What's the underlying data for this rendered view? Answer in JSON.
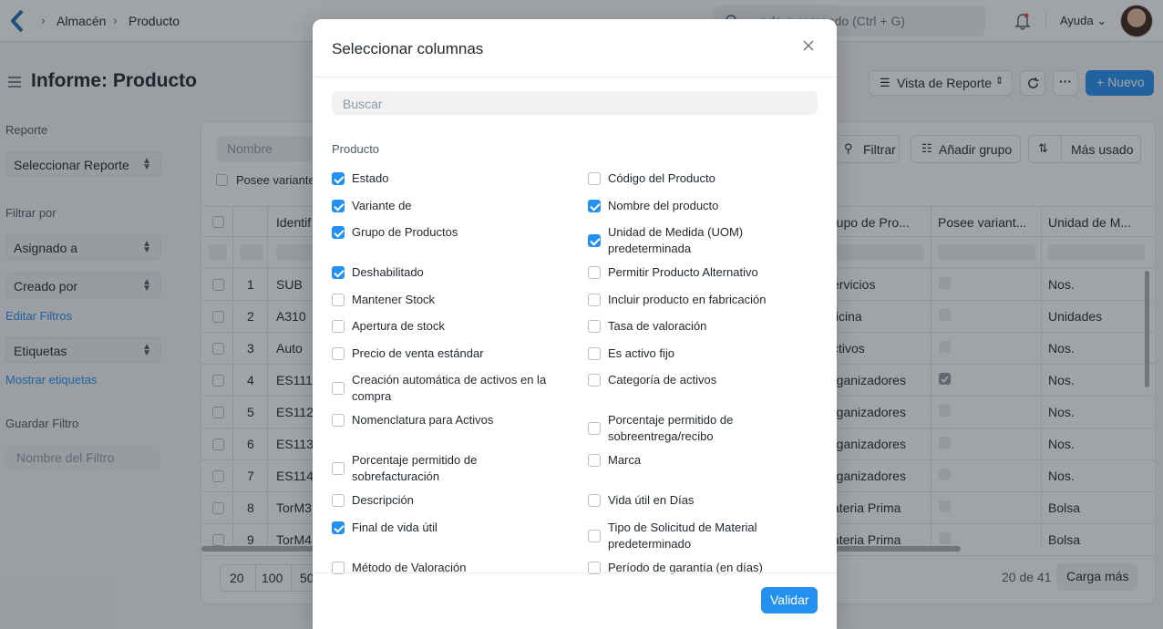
{
  "navbar": {
    "breadcrumbs": [
      "Almacén",
      "Producto"
    ],
    "search_placeholder": "Buscar o escriba una búsqueda o comando (Ctrl + G)",
    "search_visible": "...ada o comando (Ctrl + G)",
    "help_label": "Ayuda"
  },
  "header": {
    "title": "Informe: Producto",
    "view_label": "Vista de Reporte",
    "more_label": "···",
    "new_label": "+ Nuevo"
  },
  "sidebar": {
    "report_label": "Reporte",
    "report_select": "Seleccionar Reporte",
    "filter_by_label": "Filtrar por",
    "assigned_to": "Asignado a",
    "created_by": "Creado por",
    "edit_filters": "Editar Filtros",
    "tags": "Etiquetas",
    "show_tags": "Mostrar etiquetas",
    "save_filter_label": "Guardar Filtro",
    "filter_name_placeholder": "Nombre del Filtro"
  },
  "report": {
    "name_filter_placeholder": "Nombre",
    "variant_filter_label": "Posee variante",
    "filter_button": "Filtrar",
    "group_button": "Añadir grupo",
    "sort_button": "Más usado",
    "columns": [
      "Identif",
      "rupo de Pro...",
      "Posee variant...",
      "Unidad de M..."
    ],
    "rows": [
      {
        "n": "1",
        "id": "SUB",
        "group": "ervicios",
        "variant": false,
        "uom": "Nos."
      },
      {
        "n": "2",
        "id": "A310",
        "group": "ficina",
        "variant": false,
        "uom": "Unidades"
      },
      {
        "n": "3",
        "id": "Auto",
        "group": "ctivos",
        "variant": false,
        "uom": "Nos."
      },
      {
        "n": "4",
        "id": "ES111",
        "group": "rganizadores",
        "variant": true,
        "uom": "Nos."
      },
      {
        "n": "5",
        "id": "ES112",
        "group": "rganizadores",
        "variant": false,
        "uom": "Nos."
      },
      {
        "n": "6",
        "id": "ES113",
        "group": "rganizadores",
        "variant": false,
        "uom": "Nos."
      },
      {
        "n": "7",
        "id": "ES114",
        "group": "rganizadores",
        "variant": false,
        "uom": "Nos."
      },
      {
        "n": "8",
        "id": "TorM3",
        "group": "ateria Prima",
        "variant": false,
        "uom": "Bolsa"
      },
      {
        "n": "9",
        "id": "TorM4",
        "group": "ateria Prima",
        "variant": false,
        "uom": "Bolsa"
      }
    ],
    "page_sizes": [
      "20",
      "100",
      "50"
    ],
    "count_text": "20 de 41",
    "load_more": "Carga más"
  },
  "modal": {
    "title": "Seleccionar columnas",
    "search_placeholder": "Buscar",
    "section": "Producto",
    "options_left": [
      {
        "label": "Estado",
        "checked": true
      },
      {
        "label": "Variante de",
        "checked": true
      },
      {
        "label": "Grupo de Productos",
        "checked": true
      },
      {
        "label": "Deshabilitado",
        "checked": true
      },
      {
        "label": "Mantener Stock",
        "checked": false
      },
      {
        "label": "Apertura de stock",
        "checked": false
      },
      {
        "label": "Precio de venta estándar",
        "checked": false
      },
      {
        "label": "Creación automática de activos en la compra",
        "checked": false
      },
      {
        "label": "Nomenclatura para Activos",
        "checked": false
      },
      {
        "label": "Porcentaje permitido de sobrefacturación",
        "checked": false
      },
      {
        "label": "Descripción",
        "checked": false
      },
      {
        "label": "Final de vida útil",
        "checked": true
      },
      {
        "label": "Método de Valoración",
        "checked": false
      }
    ],
    "options_right": [
      {
        "label": "Código del Producto",
        "checked": false
      },
      {
        "label": "Nombre del producto",
        "checked": true
      },
      {
        "label": "Unidad de Medida (UOM) predeterminada",
        "checked": true
      },
      {
        "label": "Permitir Producto Alternativo",
        "checked": false
      },
      {
        "label": "Incluir producto en fabricación",
        "checked": false
      },
      {
        "label": "Tasa de valoración",
        "checked": false
      },
      {
        "label": "Es activo fijo",
        "checked": false
      },
      {
        "label": "Categoría de activos",
        "checked": false
      },
      {
        "label": "Porcentaje permitido de sobreentrega/recibo",
        "checked": false
      },
      {
        "label": "Marca",
        "checked": false
      },
      {
        "label": "Vida útil en Días",
        "checked": false
      },
      {
        "label": "Tipo de Solicitud de Material predeterminado",
        "checked": false
      },
      {
        "label": "Período de garantía (en días)",
        "checked": false
      }
    ],
    "validate_label": "Validar"
  },
  "colors": {
    "accent": "#2490ef"
  }
}
